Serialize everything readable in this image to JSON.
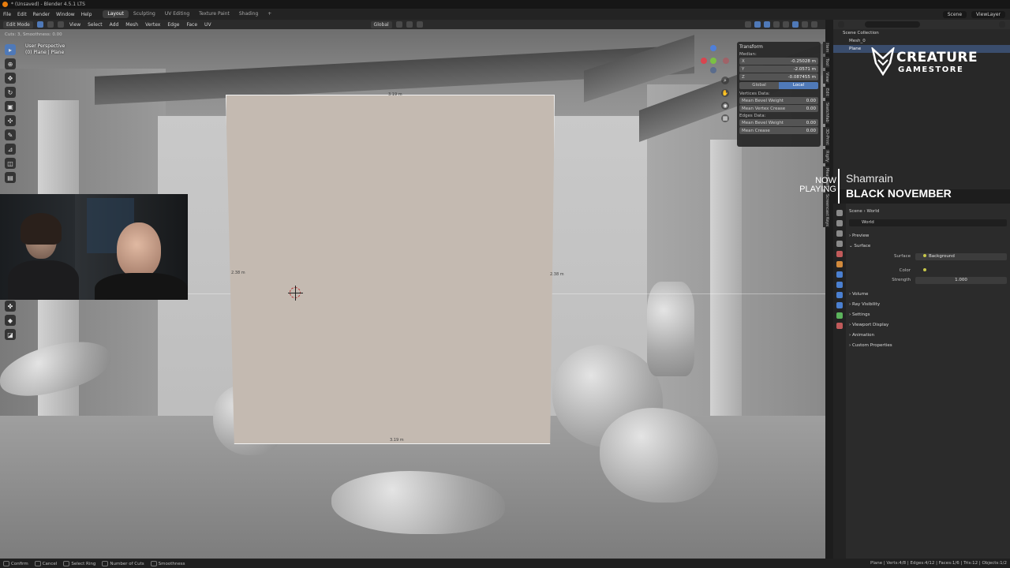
{
  "window": {
    "title": "* (Unsaved) - Blender 4.5.1 LTS"
  },
  "menu": {
    "items": [
      "File",
      "Edit",
      "Render",
      "Window",
      "Help"
    ],
    "workspaces": [
      "Layout",
      "Sculpting",
      "UV Editing",
      "Texture Paint",
      "Shading"
    ],
    "add_workspace": "+",
    "scene": "Scene",
    "view_layer": "ViewLayer"
  },
  "viewport_header": {
    "mode": "Edit Mode",
    "menus": [
      "View",
      "Select",
      "Add",
      "Mesh",
      "Vertex",
      "Edge",
      "Face",
      "UV"
    ],
    "orientation": "Global"
  },
  "operator_status": "Cuts: 3, Smoothness: 0.00",
  "viewport_info": {
    "perspective": "User Perspective",
    "object": "(0) Plane | Plane"
  },
  "dimensions": {
    "top": "3.19 m",
    "bottom": "3.19 m",
    "left": "2.38 m",
    "right": "2.38 m"
  },
  "transform_panel": {
    "title": "Transform",
    "median_label": "Median:",
    "x_label": "X",
    "x_value": "-0.25028 m",
    "y_label": "Y",
    "y_value": "-2.0571 m",
    "z_label": "Z",
    "z_value": "-0.087455 m",
    "space_global": "Global",
    "space_local": "Local",
    "vertices_label": "Vertices Data:",
    "mean_bevel_weight_label": "Mean Bevel Weight",
    "mean_bevel_weight_value": "0.00",
    "mean_vertex_crease_label": "Mean Vertex Crease",
    "mean_vertex_crease_value": "0.00",
    "edges_label": "Edges Data:",
    "edge_bevel_weight_label": "Mean Bevel Weight",
    "edge_bevel_weight_value": "0.00",
    "mean_crease_label": "Mean Crease",
    "mean_crease_value": "0.00"
  },
  "sidebar_tabs": [
    "Item",
    "Tool",
    "View",
    "Edit",
    "Sketchfab",
    "3D-Print",
    "Rigify",
    "MeasureIt",
    "Screencast Keys"
  ],
  "outliner": {
    "search_placeholder": "",
    "root": "Scene Collection",
    "items": [
      "Mesh_0",
      "Plane"
    ]
  },
  "overlay": {
    "brand_name": "CREATURE",
    "brand_sub": "GAMESTORE",
    "now_playing": "NOW PLAYING",
    "artist": "Shamrain",
    "track": "BLACK NOVEMBER"
  },
  "properties": {
    "breadcrumb_scene": "Scene",
    "breadcrumb_world": "World",
    "world_field": "World",
    "preview": "Preview",
    "surface": "Surface",
    "surface_label": "Surface",
    "surface_value": "Background",
    "color_label": "Color",
    "strength_label": "Strength",
    "strength_value": "1.000",
    "sections": [
      "Volume",
      "Ray Visibility",
      "Settings",
      "Viewport Display",
      "Animation",
      "Custom Properties"
    ]
  },
  "statusbar": {
    "confirm": "Confirm",
    "cancel": "Cancel",
    "select_ring": "Select Ring",
    "number_of_cuts": "Number of Cuts",
    "smoothness": "Smoothness",
    "stats": "Plane | Verts:4/8 | Edges:4/12 | Faces:1/6 | Tris:12 | Objects:1/2"
  },
  "colors": {
    "accent": "#4f79b8",
    "plane_face": "#c4bab1",
    "blender_logo": "#e87d0d"
  }
}
